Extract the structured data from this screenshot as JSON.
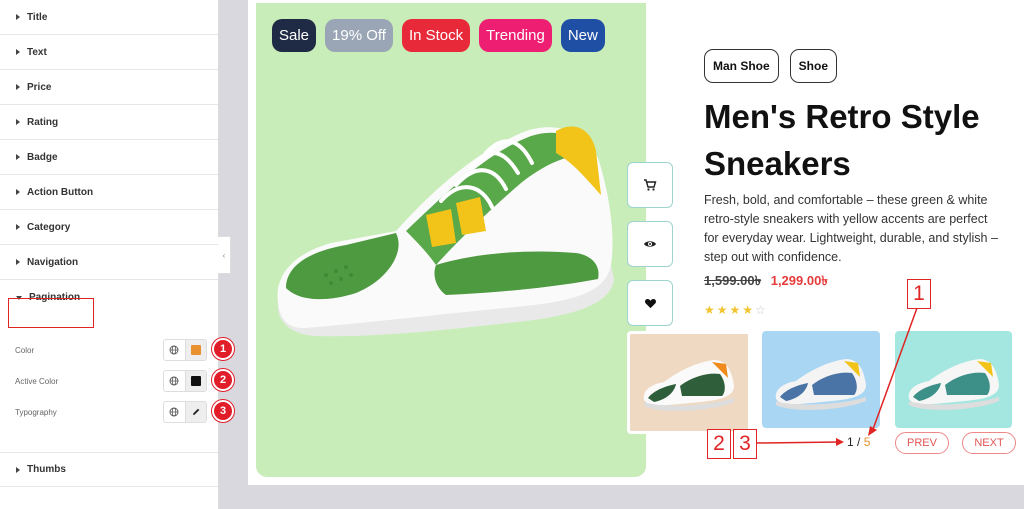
{
  "panel": {
    "sections": [
      "Title",
      "Text",
      "Price",
      "Rating",
      "Badge",
      "Action Button",
      "Category",
      "Navigation",
      "Pagination"
    ],
    "pagination_controls": [
      {
        "label": "Color",
        "swatch": "#e8912e",
        "tool": "swatch"
      },
      {
        "label": "Active Color",
        "swatch": "#111111",
        "tool": "swatch"
      },
      {
        "label": "Typography",
        "tool": "pencil-icon"
      }
    ],
    "thumbs_section": "Thumbs",
    "markers": [
      "1",
      "2",
      "3"
    ]
  },
  "product": {
    "badges": [
      {
        "label": "Sale",
        "color": "#1f2a44"
      },
      {
        "label": "19% Off",
        "color": "#9aa6b5"
      },
      {
        "label": "In Stock",
        "color": "#e8293a"
      },
      {
        "label": "Trending",
        "color": "#ee1f72"
      },
      {
        "label": "New",
        "color": "#1f4fa5"
      }
    ],
    "categories": [
      "Man Shoe",
      "Shoe"
    ],
    "title": "Men's Retro Style Sneakers",
    "description": "Fresh, bold, and comfortable – these green & white retro-style sneakers with yellow accents are perfect for everyday wear. Lightweight, durable, and stylish – step out with confidence.",
    "old_price": "1,599.00৳",
    "price": "1,299.00৳",
    "rating_stars_filled": 4,
    "rating_stars_total": 5,
    "actions": [
      "cart-icon",
      "eye-icon",
      "heart-icon"
    ]
  },
  "pagination": {
    "current": "1",
    "separator": "/",
    "total": "5",
    "prev": "PREV",
    "next": "NEXT"
  },
  "callouts": {
    "box_1": "1",
    "box_2": "2",
    "box_3": "3"
  },
  "colors": {
    "accent_red": "#e02424",
    "image_bg": "#c8edb8",
    "pagination_total": "#e3962e"
  }
}
